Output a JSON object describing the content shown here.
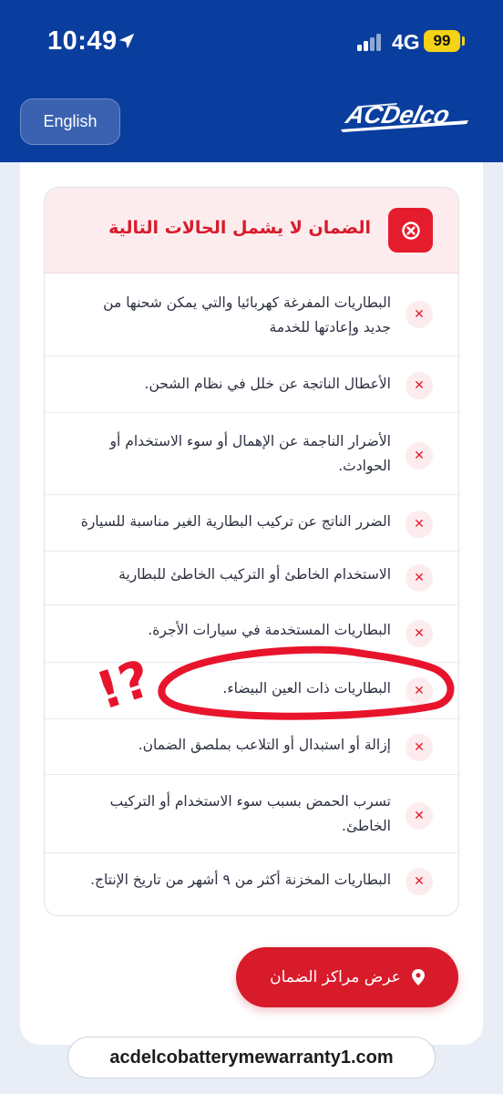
{
  "status_bar": {
    "time": "10:49",
    "network": "4G",
    "battery": "99"
  },
  "header": {
    "language_button": "English",
    "logo_text": "ACDelco"
  },
  "exclusions": {
    "title": "الضمان لا يشمل الحالات التالية",
    "items": [
      "البطاريات المفرغة كهربائيا والتي يمكن شحنها من جديد وإعادتها للخدمة",
      "الأعطال الناتجة عن خلل في نظام الشحن.",
      "الأضرار الناجمة عن الإهمال أو سوء الاستخدام أو الحوادث.",
      "الضرر الناتج عن تركيب البطارية الغير مناسبة للسيارة",
      "الاستخدام الخاطئ أو التركيب الخاطئ للبطارية",
      "البطاريات المستخدمة في سيارات الأجرة.",
      "البطاريات ذات العين البيضاء.",
      "إزالة أو استبدال أو التلاعب بملصق الضمان.",
      "تسرب الحمض بسبب سوء الاستخدام أو التركيب الخاطئ.",
      "البطاريات المخزنة أكثر من ٩ أشهر من تاريخ الإنتاج."
    ],
    "item_icon": "x-mark-icon"
  },
  "cta": {
    "label": "عرض مراكز الضمان",
    "icon": "location-pin-icon"
  },
  "browser": {
    "url": "acdelcobatterymewarranty1.com"
  },
  "annotation": {
    "text": "!?",
    "color": "#e8142c"
  },
  "colors": {
    "header_bg": "#0a3e9e",
    "accent_red": "#d81b2b",
    "panel_head_bg": "#fdeced"
  }
}
